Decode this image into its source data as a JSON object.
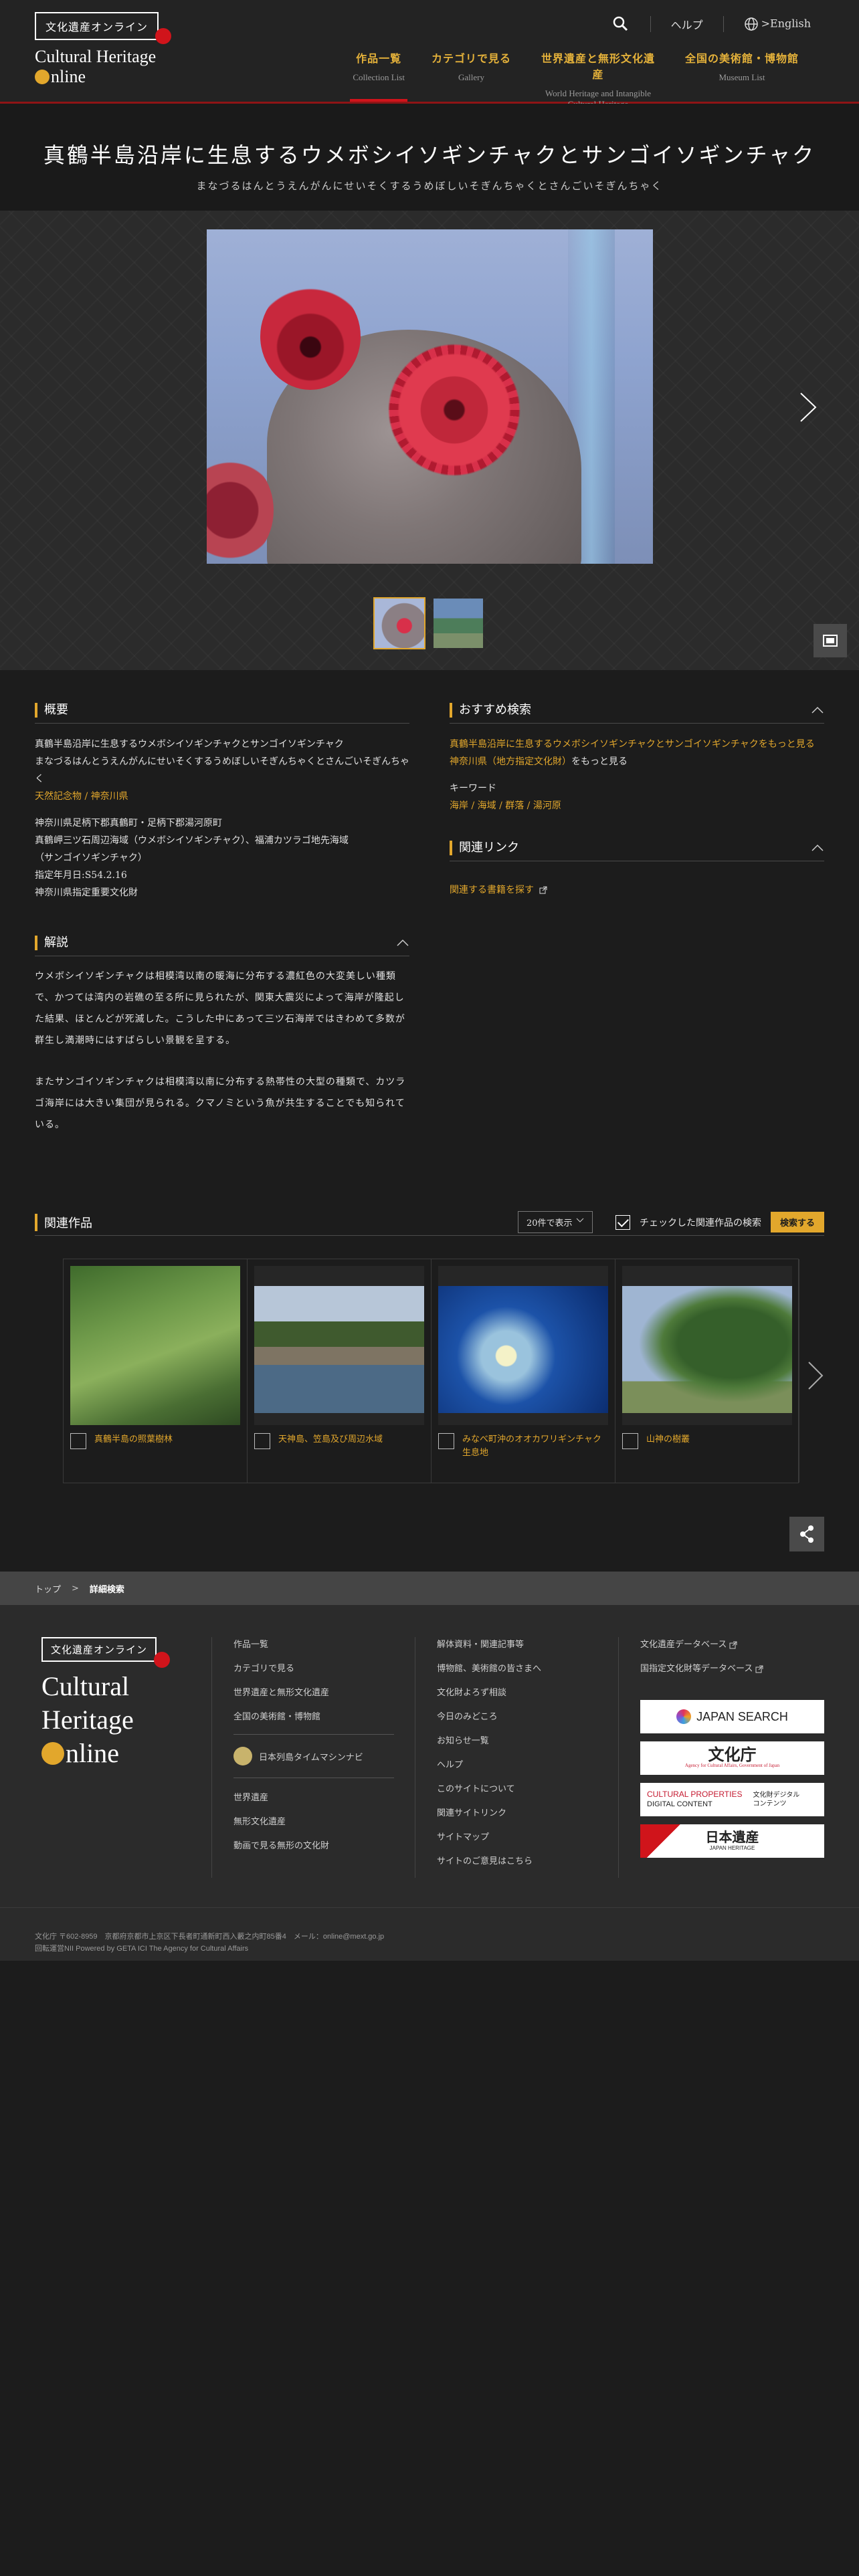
{
  "header": {
    "logo_ja": "文化遺産オンライン",
    "logo_en_line1": "Cultural Heritage",
    "logo_en_line2": "nline",
    "help": "ヘルプ",
    "english": ">English",
    "nav": [
      {
        "ja": "作品一覧",
        "en": "Collection List"
      },
      {
        "ja": "カテゴリで見る",
        "en": "Gallery"
      },
      {
        "ja": "世界遺産と無形文化遺産",
        "en": "World Heritage and Intangible Cultural Heritage"
      },
      {
        "ja": "全国の美術館・博物館",
        "en": "Museum List"
      }
    ]
  },
  "title": {
    "main": "真鶴半島沿岸に生息するウメボシイソギンチャクとサンゴイソギンチャク",
    "kana": "まなづるはんとうえんがんにせいそくするうめぼしいそぎんちゃくとさんごいそぎんちゃく"
  },
  "overview": {
    "heading": "概要",
    "name": "真鶴半島沿岸に生息するウメボシイソギンチャクとサンゴイソギンチャク",
    "kana": "まなづるはんとうえんがんにせいそくするうめぼしいそぎんちゃくとさんごいそぎんちゃく",
    "category": "天然記念物 / 神奈川県",
    "lines": [
      "神奈川県足柄下郡真鶴町・足柄下郡湯河原町",
      "真鶴岬三ツ石周辺海域（ウメボシイソギンチャク）、福浦カツラゴ地先海域",
      "（サンゴイソギンチャク）",
      "指定年月日:S54.2.16",
      "神奈川県指定重要文化財"
    ]
  },
  "description": {
    "heading": "解説",
    "p1": "ウメボシイソギンチャクは相模湾以南の暖海に分布する濃紅色の大変美しい種類で、かつては湾内の岩礁の至る所に見られたが、関東大震災によって海岸が隆起した結果、ほとんどが死滅した。こうした中にあって三ツ石海岸ではきわめて多数が群生し満潮時にはすばらしい景観を呈する。",
    "p2": "またサンゴイソギンチャクは相模湾以南に分布する熱帯性の大型の種類で、カツラゴ海岸には大きい集団が見られる。クマノミという魚が共生することでも知られている。"
  },
  "recommend": {
    "heading": "おすすめ検索",
    "link1": "真鶴半島沿岸に生息するウメボシイソギンチャクとサンゴイソギンチャクをもっと見る",
    "link2": "神奈川県（地方指定文化財）",
    "link2_suffix": "をもっと見る",
    "keyword_label": "キーワード",
    "keywords": "海岸 / 海域 / 群落 / 湯河原"
  },
  "links": {
    "heading": "関連リンク",
    "books": "関連する書籍を探す"
  },
  "related": {
    "heading": "関連作品",
    "per_page": "20件で表示",
    "checked_search": "チェックした関連作品の検索",
    "search_btn": "検索する",
    "items": [
      {
        "title": "真鶴半島の照葉樹林"
      },
      {
        "title": "天神島、笠島及び周辺水域"
      },
      {
        "title": "みなべ町沖のオオカワリギンチャク生息地"
      },
      {
        "title": "山神の樹叢"
      }
    ]
  },
  "breadcrumb": {
    "home": "トップ",
    "sep": ">",
    "current": "詳細検索"
  },
  "footer": {
    "logo_ja": "文化遺産オンライン",
    "big1": "Cultural",
    "big2": "Heritage",
    "big3": "nline",
    "col1": [
      "作品一覧",
      "カテゴリで見る",
      "世界遺産と無形文化遺産",
      "全国の美術館・博物館"
    ],
    "timemachine": "日本列島タイムマシンナビ",
    "col1b": [
      "世界遺産",
      "無形文化遺産",
      "動画で見る無形の文化財"
    ],
    "col2": [
      "解体資料・関連記事等",
      "博物館、美術館の皆さまへ",
      "文化財よろず相談",
      "今日のみどころ",
      "お知らせ一覧",
      "ヘルプ",
      "このサイトについて",
      "関連サイトリンク",
      "サイトマップ",
      "サイトのご意見はこちら"
    ],
    "col3": [
      "文化遺産データベース",
      "国指定文化財等データベース"
    ],
    "banners": {
      "japan_search": "JAPAN SEARCH",
      "bunkacho": "文化庁",
      "bunkacho_sub": "Agency for Cultural Affairs, Government of Japan",
      "cp_line1": "CULTURAL PROPERTIES",
      "cp_line2": "DIGITAL CONTENT",
      "cp_ja": "文化財デジタルコンテンツ",
      "nihon_isan": "日本遺産",
      "nihon_isan_en": "JAPAN HERITAGE"
    },
    "address": "文化庁 〒602-8959　京都府京都市上京区下長者町通新町西入藪之内町85番4　メール：online@mext.go.jp",
    "powered": "回転運営NII Powered by GETA ICI The Agency for Cultural Affairs"
  },
  "colors": {
    "accent": "#e2a72c",
    "brand_red": "#d0141b",
    "bg": "#1c1c1c"
  }
}
